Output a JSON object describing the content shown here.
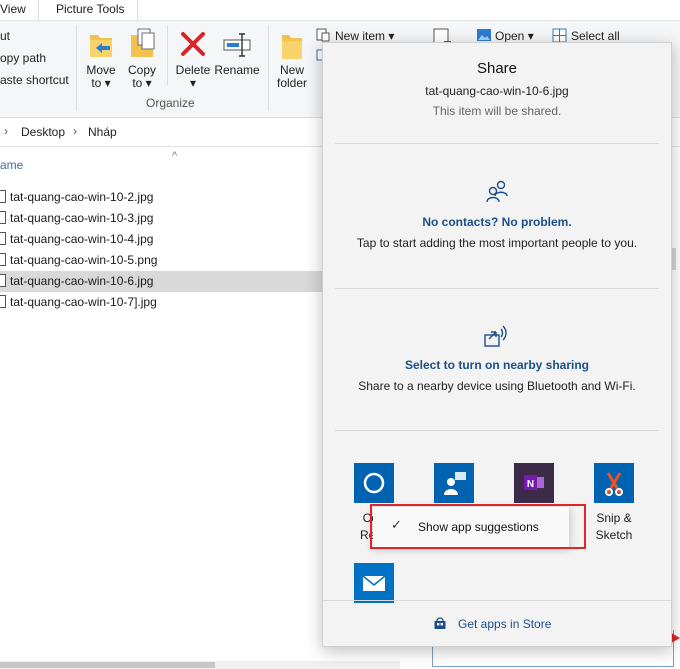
{
  "ribbon": {
    "tabs": [
      "View",
      "Picture Tools"
    ],
    "clipboard_items": [
      "ut",
      "opy path",
      "aste shortcut"
    ],
    "buttons": {
      "move_to": [
        "Move",
        "to ▾"
      ],
      "copy_to": [
        "Copy",
        "to ▾"
      ],
      "delete": [
        "Delete",
        "▾"
      ],
      "rename": "Rename",
      "new_folder": [
        "New",
        "folder"
      ]
    },
    "new_item": "New item ▾",
    "open": "Open ▾",
    "select_all": "Select all",
    "organize_label": "Organize"
  },
  "address": {
    "crumbs": [
      "Desktop",
      "Nháp"
    ]
  },
  "filelist": {
    "column_header": "ame",
    "files": [
      "tat-quang-cao-win-10-2.jpg",
      "tat-quang-cao-win-10-3.jpg",
      "tat-quang-cao-win-10-4.jpg",
      "tat-quang-cao-win-10-5.png",
      "tat-quang-cao-win-10-6.jpg",
      "tat-quang-cao-win-10-7].jpg"
    ],
    "selected_index": 4
  },
  "share": {
    "title": "Share",
    "filename": "tat-quang-cao-win-10-6.jpg",
    "subtitle": "This item will be shared.",
    "contacts_title": "No contacts? No problem.",
    "contacts_desc": "Tap to start adding the most important people to you.",
    "nearby_title": "Select to turn on nearby sharing",
    "nearby_desc": "Share to a nearby device using Bluetooth and Wi-Fi.",
    "apps": [
      {
        "label": "Cort",
        "label2": "Remi",
        "icon": "cortana-icon",
        "color": "#0063b1"
      },
      {
        "label": "",
        "label2": "",
        "icon": "people-icon",
        "color": "#0063b1"
      },
      {
        "label": "",
        "label2": "",
        "icon": "onenote-icon",
        "color": "#7719aa"
      },
      {
        "label": "Snip &",
        "label2": "Sketch",
        "icon": "snip-sketch-icon",
        "color": "#0063b1"
      },
      {
        "label": "",
        "label2": "",
        "icon": "mail-icon",
        "color": "#0072c6"
      }
    ],
    "store_link": "Get apps in Store"
  },
  "context_menu": {
    "item": "Show app suggestions",
    "checked": true
  },
  "colors": {
    "accent": "#0063b1",
    "link_blue": "#1b4f8a",
    "highlight_red": "#e1262b"
  }
}
